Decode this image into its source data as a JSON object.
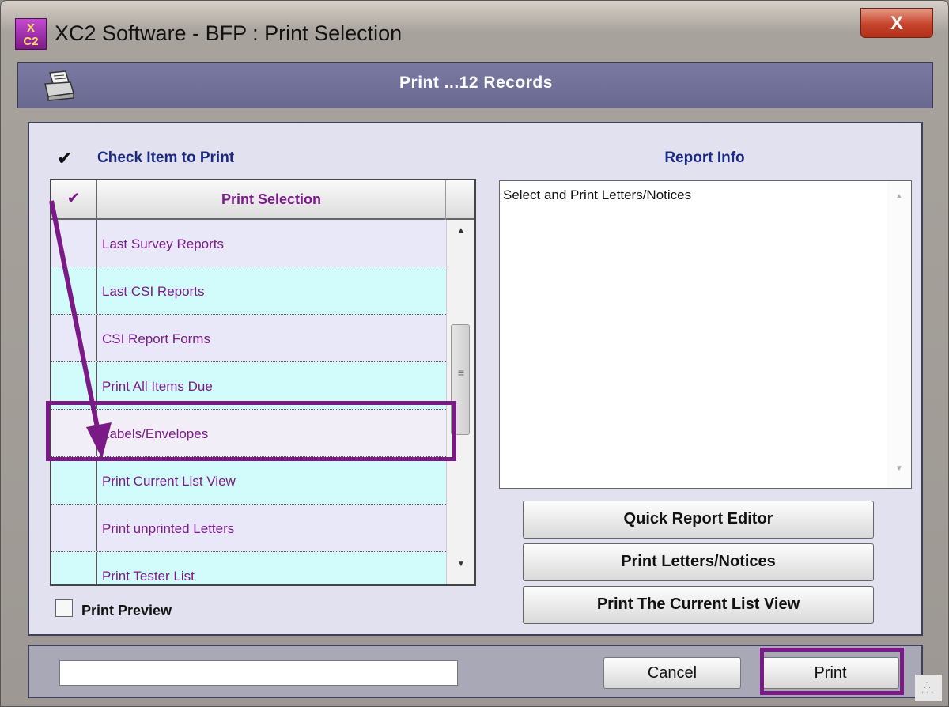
{
  "window": {
    "title": "XC2 Software - BFP : Print Selection",
    "app_icon_text": "XC2",
    "close_label": "X"
  },
  "header": {
    "title": "Print ...12 Records",
    "icon": "printer-icon"
  },
  "left_panel": {
    "check_icon": "✔",
    "label": "Check Item to Print",
    "list": {
      "header_check": "✔",
      "header_label": "Print Selection",
      "rows": [
        {
          "label": "Last Survey Reports"
        },
        {
          "label": "Last CSI Reports"
        },
        {
          "label": "CSI Report Forms"
        },
        {
          "label": "Print All Items Due"
        },
        {
          "label": "Labels/Envelopes",
          "highlighted": true
        },
        {
          "label": "Print Current List View"
        },
        {
          "label": "Print unprinted Letters"
        },
        {
          "label": "Print Tester List"
        }
      ]
    },
    "print_preview_label": "Print Preview",
    "print_preview_checked": false
  },
  "right_panel": {
    "title": "Report Info",
    "info_text": "Select and Print Letters/Notices",
    "buttons": [
      "Quick Report Editor",
      "Print Letters/Notices",
      "Print The Current List View"
    ]
  },
  "footer": {
    "status_value": "",
    "cancel_label": "Cancel",
    "print_label": "Print"
  },
  "colors": {
    "accent": "#7b1a86",
    "header_band": "#6f6e96",
    "row_cyan": "#d2fbfb",
    "row_lavender": "#e8e8f8",
    "title_blue": "#1b2a80"
  }
}
